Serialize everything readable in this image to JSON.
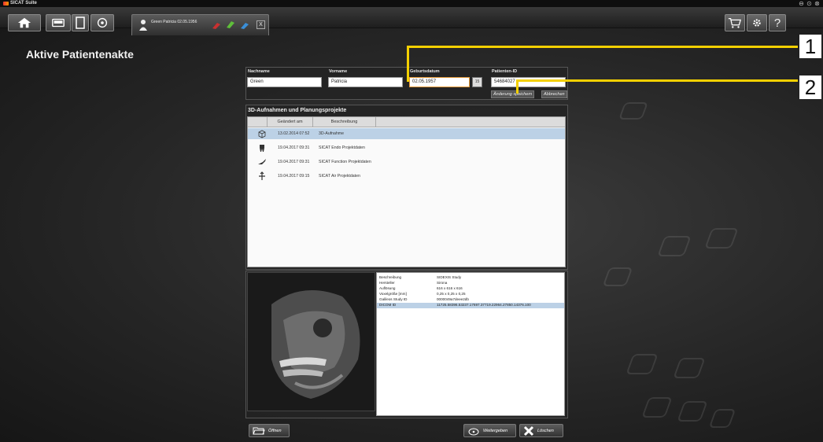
{
  "app": {
    "title": "SICAT Suite"
  },
  "toolbar": {
    "patient_tab": "Green Patricia 02.05.1956",
    "close_label": "X",
    "help_label": "?"
  },
  "page_title": "Aktive Patientenakte",
  "patient": {
    "lastname_label": "Nachname",
    "lastname": "Green",
    "firstname_label": "Vorname",
    "firstname": "Patricia",
    "dob_label": "Geburtsdatum",
    "dob": "02.05.1957",
    "calendar_label": "15",
    "id_label": "Patienten-ID",
    "id": "54684027",
    "save_label": "Änderung speichern",
    "cancel_label": "Abbrechen"
  },
  "studies": {
    "title": "3D-Aufnahmen und Planungsprojekte",
    "col_date": "Geändert am",
    "col_desc": "Beschreibung",
    "rows": [
      {
        "icon": "cube-icon",
        "date": "13.02.2014 07:52",
        "desc": "3D-Aufnahme"
      },
      {
        "icon": "tooth-icon",
        "date": "19.04.2017 09:31",
        "desc": "SICAT Endo Projektdaten"
      },
      {
        "icon": "jaw-icon",
        "date": "19.04.2017 09:31",
        "desc": "SICAT Function Projektdaten"
      },
      {
        "icon": "airway-icon",
        "date": "19.04.2017 09:15",
        "desc": "SICAT Air Projektdaten"
      }
    ]
  },
  "properties": [
    {
      "k": "Beschreibung",
      "v": "SIDEXIS Study"
    },
    {
      "k": "Hersteller",
      "v": "Sirona"
    },
    {
      "k": "Auflösung",
      "v": "616 x 616 x 616"
    },
    {
      "k": "Voxelgröße [mm]",
      "v": "0,25 x 0,25 x 0,25"
    },
    {
      "k": "Galileos Study ID",
      "v": "0000049a7deee2db"
    },
    {
      "k": "DICOM ID",
      "v": "11725.58396.53237.17697.37719.22964.27850.14376.100"
    }
  ],
  "buttons": {
    "open": "Öffnen",
    "forward": "Weitergeben",
    "delete": "Löschen"
  },
  "callouts": [
    "1",
    "2"
  ],
  "colors": {
    "accent": "#f4d000",
    "selection": "#bcd1e6",
    "active_field": "#e49a3a"
  }
}
